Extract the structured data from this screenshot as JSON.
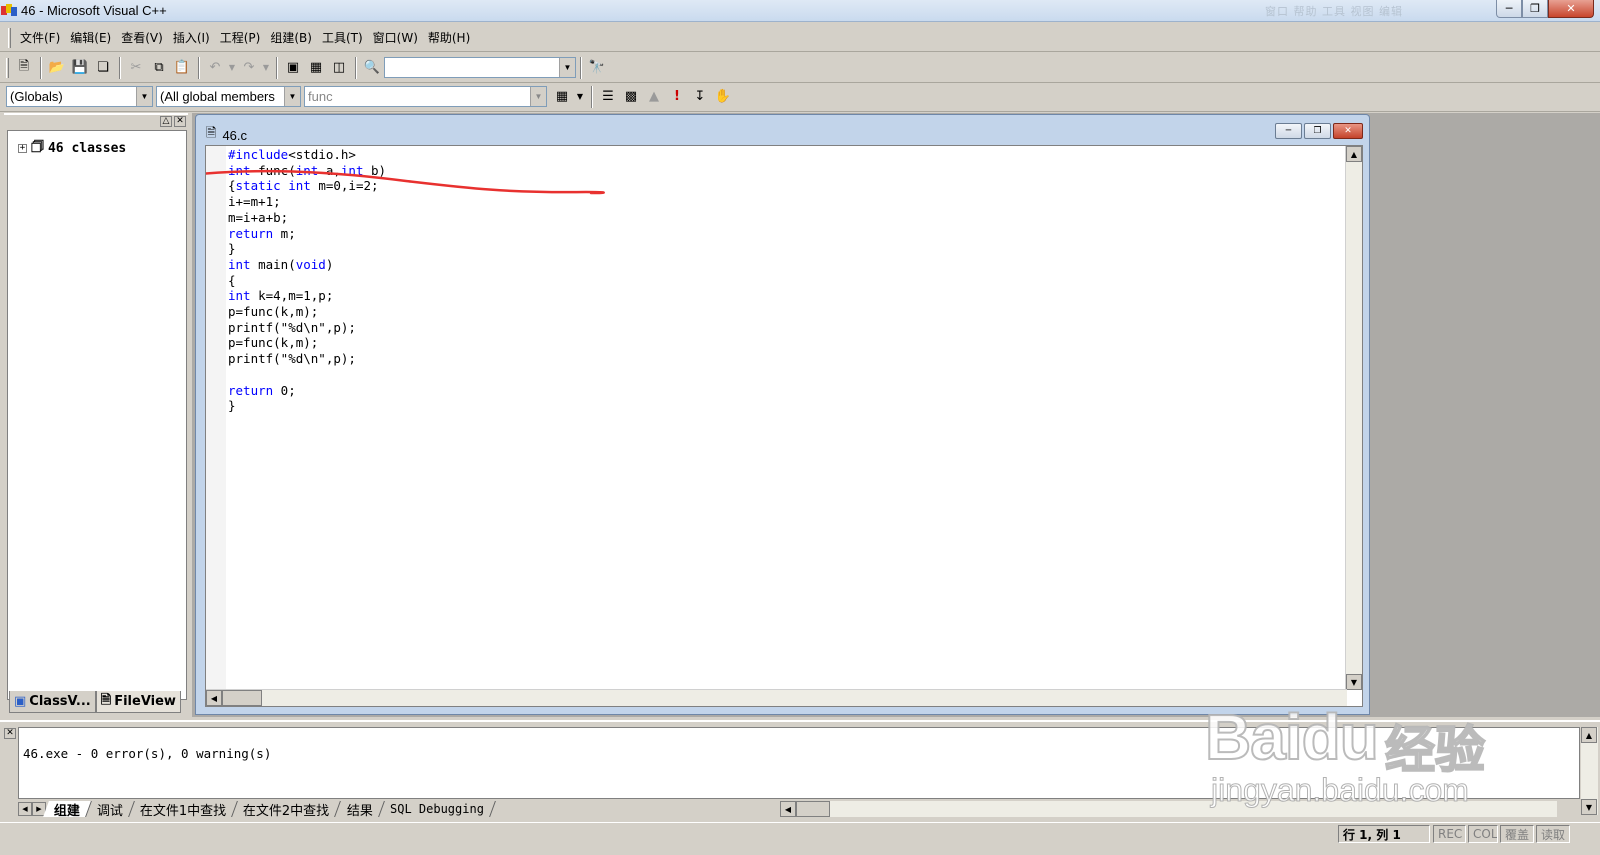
{
  "window": {
    "title": "46 - Microsoft Visual C++",
    "faded_menu": "窗口   帮助   工具   视图   编辑"
  },
  "menu": [
    "文件(F)",
    "编辑(E)",
    "查看(V)",
    "插入(I)",
    "工程(P)",
    "组建(B)",
    "工具(T)",
    "窗口(W)",
    "帮助(H)"
  ],
  "toolbar": {
    "find_combo_value": "",
    "scope_combo": "(Globals)",
    "members_combo": "(All global members",
    "function_combo": "func"
  },
  "workspace": {
    "tree_root": "46 classes",
    "tabs": [
      "ClassV...",
      "FileView"
    ]
  },
  "document": {
    "title": "46.c",
    "code_lines": [
      [
        {
          "t": "#include",
          "k": true
        },
        {
          "t": "<stdio.h>"
        }
      ],
      [
        {
          "t": "int",
          "k": true
        },
        {
          "t": " func("
        },
        {
          "t": "int",
          "k": true
        },
        {
          "t": " a,"
        },
        {
          "t": "int",
          "k": true
        },
        {
          "t": " b)"
        }
      ],
      [
        {
          "t": "{"
        },
        {
          "t": "static",
          "k": true
        },
        {
          "t": " "
        },
        {
          "t": "int",
          "k": true
        },
        {
          "t": " m=0,i=2;"
        }
      ],
      [
        {
          "t": "i+=m+1;"
        }
      ],
      [
        {
          "t": "m=i+a+b;"
        }
      ],
      [
        {
          "t": "return",
          "k": true
        },
        {
          "t": " m;"
        }
      ],
      [
        {
          "t": "}"
        }
      ],
      [
        {
          "t": "int",
          "k": true
        },
        {
          "t": " main("
        },
        {
          "t": "void",
          "k": true
        },
        {
          "t": ")"
        }
      ],
      [
        {
          "t": "{"
        }
      ],
      [
        {
          "t": "int",
          "k": true
        },
        {
          "t": " k=4,m=1,p;"
        }
      ],
      [
        {
          "t": "p=func(k,m);"
        }
      ],
      [
        {
          "t": "printf(\"%d\\n\",p);"
        }
      ],
      [
        {
          "t": "p=func(k,m);"
        }
      ],
      [
        {
          "t": "printf(\"%d\\n\",p);"
        }
      ],
      [
        {
          "t": ""
        }
      ],
      [
        {
          "t": "return",
          "k": true
        },
        {
          "t": " 0;"
        }
      ],
      [
        {
          "t": "}"
        }
      ]
    ]
  },
  "output": {
    "message": "46.exe - 0 error(s), 0 warning(s)",
    "tabs": [
      "组建",
      "调试",
      "在文件1中查找",
      "在文件2中查找",
      "结果",
      "SQL Debugging"
    ]
  },
  "status": {
    "position": "行 1, 列 1",
    "indicators": [
      "REC",
      "COL",
      "覆盖",
      "读取"
    ]
  },
  "watermark": {
    "brand": "Baidu",
    "cn": "经验",
    "url": "jingyan.baidu.com"
  },
  "colors": {
    "keyword": "#0000ff",
    "annotation": "#e8312f",
    "title_gradient": "#c9daee"
  }
}
